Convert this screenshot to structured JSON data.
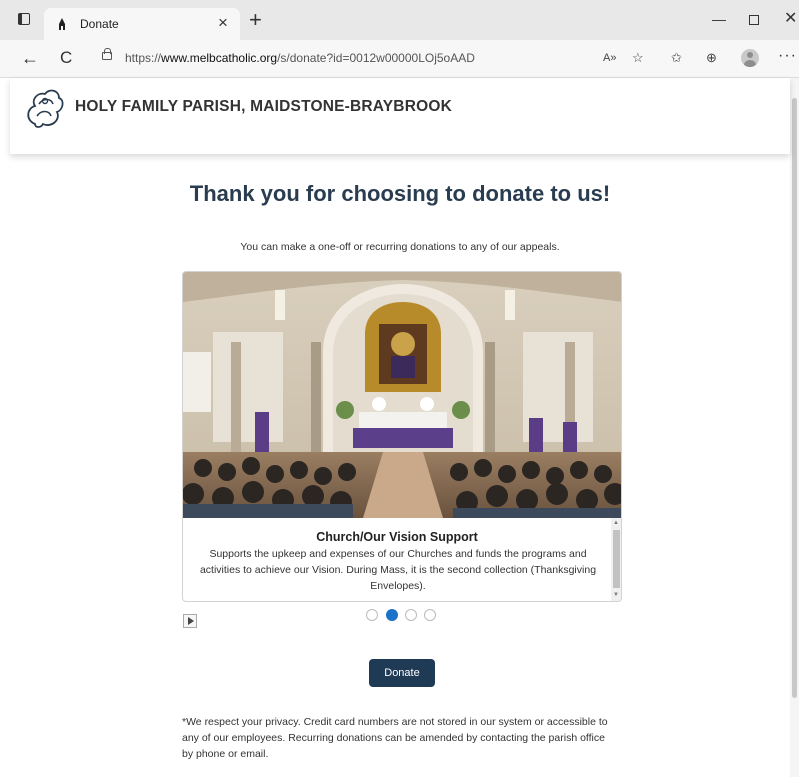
{
  "browser": {
    "tab_title": "Donate",
    "tab_close": "×",
    "new_tab": "+",
    "window_min": "—",
    "window_close": "✕",
    "back": "←",
    "reload": "C",
    "url_prefix": "https://",
    "url_domain": "www.melbcatholic.org",
    "url_path": "/s/donate?id=0012w00000LOj5oAAD",
    "read_aloud": "A»",
    "favorite": "☆",
    "favorites_bar": "✩",
    "collections": "⊕",
    "more": "···"
  },
  "site": {
    "parish_name": "HOLY FAMILY PARISH, MAIDSTONE-BRAYBROOK",
    "logo_name": "holy-family-logo"
  },
  "main": {
    "heading": "Thank you for choosing to donate to us!",
    "subtitle": "You can make a one-off or recurring donations to any of our appeals.",
    "carousel": {
      "image_alt": "church interior",
      "title": "Church/Our Vision Support",
      "description": "Supports the upkeep and expenses of our Churches and funds the programs and activities to achieve our Vision. During Mass, it is the second collection (Thanksgiving Envelopes).",
      "scroll_up": "▲",
      "scroll_down": "▼",
      "slide_count": 4,
      "active_slide": 2
    },
    "donate_label": "Donate",
    "privacy": "*We respect your privacy. Credit card numbers are not stored in our system or accessible to any of our employees. Recurring donations can be amended by contacting the parish office by phone or email."
  },
  "colors": {
    "heading": "#2a3c4f",
    "donate_button": "#1e3a55",
    "active_dot": "#1a73c8"
  }
}
